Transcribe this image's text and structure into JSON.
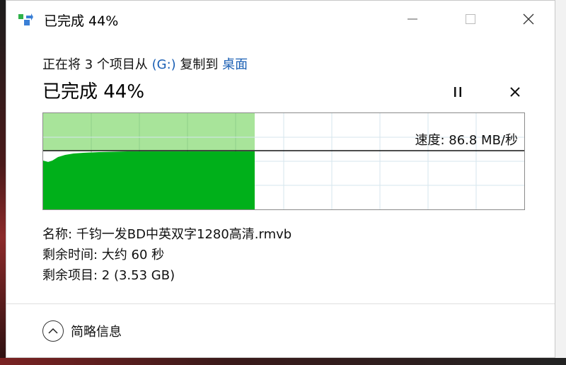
{
  "window": {
    "title": "已完成 44%"
  },
  "status": {
    "copy_prefix": "正在将 3 个项目从",
    "source": "(G:)",
    "copy_mid": "复制到",
    "destination": "桌面",
    "heading": "已完成 44%",
    "progress_percent": 44
  },
  "graph": {
    "speed_label": "速度: 86.8 MB/秒"
  },
  "details": {
    "name": "名称: 千钧一发BD中英双字1280高清.rmvb",
    "time_remaining": "剩余时间: 大约 60 秒",
    "items_remaining": "剩余项目: 2 (3.53 GB)"
  },
  "footer": {
    "toggle_label": "简略信息"
  },
  "colors": {
    "progress_fill": "#00b01a",
    "progress_light": "#a8e49a",
    "link": "#1a5fb4"
  }
}
